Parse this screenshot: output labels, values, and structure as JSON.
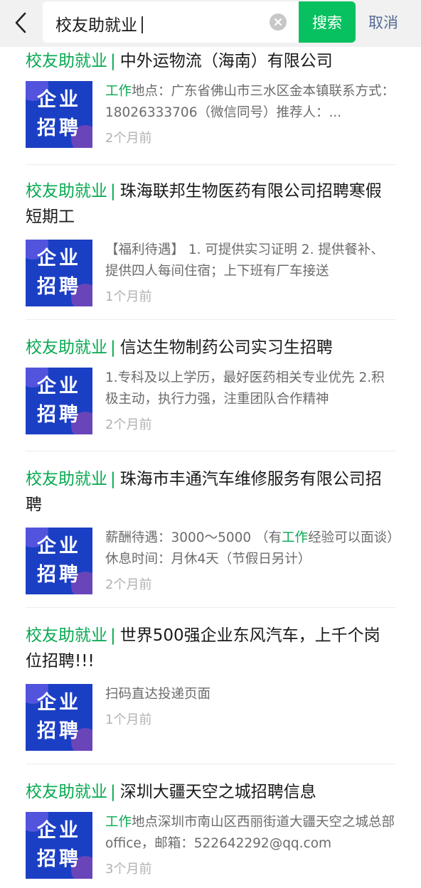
{
  "search": {
    "query": "校友助就业",
    "button_label": "搜索",
    "cancel_label": "取消"
  },
  "icons": {
    "back": "chevron-left-icon",
    "clear": "clear-circle-icon"
  },
  "colors": {
    "accent_green": "#07c160",
    "link_blue": "#576b95",
    "thumb_blue": "#1b3fc4"
  },
  "results": [
    {
      "source": "校友助就业",
      "title": "中外运物流（海南）有限公司",
      "thumb_line1": "企业",
      "thumb_line2": "招聘",
      "desc_highlight": "工作",
      "desc": "地点：广东省佛山市三水区金本镇联系方式：18026333706（微信同号）推荐人：...",
      "time": "2个月前"
    },
    {
      "source": "校友助就业",
      "title": "珠海联邦生物医药有限公司招聘寒假短期工",
      "thumb_line1": "企业",
      "thumb_line2": "招聘",
      "desc_highlight": "",
      "desc": "【福利待遇】 1. 可提供实习证明 2. 提供餐补、提供四人每间住宿；上下班有厂车接送",
      "time": "1个月前"
    },
    {
      "source": "校友助就业",
      "title": "信达生物制药公司实习生招聘",
      "thumb_line1": "企业",
      "thumb_line2": "招聘",
      "desc_highlight": "",
      "desc": "1.专科及以上学历，最好医药相关专业优先 2.积极主动，执行力强，注重团队合作精神",
      "time": "2个月前"
    },
    {
      "source": "校友助就业",
      "title": "珠海市丰通汽车维修服务有限公司招聘",
      "thumb_line1": "企业",
      "thumb_line2": "招聘",
      "desc_pre": "薪酬待遇：3000～5000 （有",
      "desc_highlight": "工作",
      "desc": "经验可以面谈）休息时间：月休4天（节假日另计）",
      "time": "2个月前"
    },
    {
      "source": "校友助就业",
      "title": "世界500强企业东风汽车，上千个岗位招聘!!!",
      "thumb_line1": "企业",
      "thumb_line2": "招聘",
      "desc_highlight": "",
      "desc": "扫码直达投递页面",
      "time": "1个月前"
    },
    {
      "source": "校友助就业",
      "title": "深圳大疆天空之城招聘信息",
      "thumb_line1": "企业",
      "thumb_line2": "招聘",
      "desc_highlight": "工作",
      "desc": "地点深圳市南山区西丽街道大疆天空之城总部office，邮箱：522642292@qq.com",
      "time": "3个月前"
    }
  ]
}
